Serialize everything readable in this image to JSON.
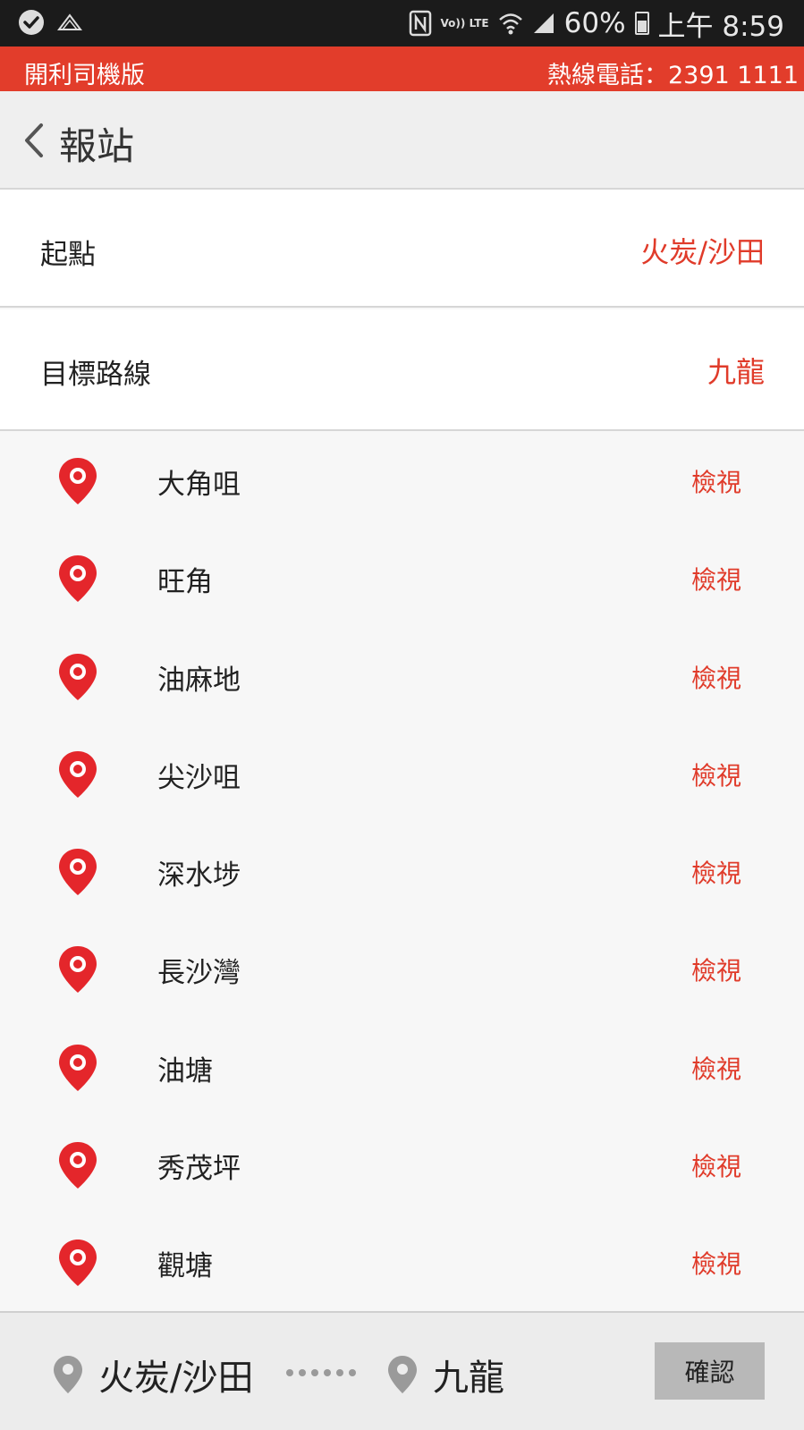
{
  "status_bar": {
    "battery": "60%",
    "time": "上午 8:59",
    "volte_label": "Vo)) LTE"
  },
  "banner": {
    "app_name": "開利司機版",
    "hotline": "熱線電話：2391 1111"
  },
  "header": {
    "title": "報站"
  },
  "origin": {
    "label": "起點",
    "value": "火炭/沙田"
  },
  "route": {
    "label": "目標路線",
    "value": "九龍"
  },
  "stations": [
    {
      "name": "大角咀",
      "action": "檢視"
    },
    {
      "name": "旺角",
      "action": "檢視"
    },
    {
      "name": "油麻地",
      "action": "檢視"
    },
    {
      "name": "尖沙咀",
      "action": "檢視"
    },
    {
      "name": "深水埗",
      "action": "檢視"
    },
    {
      "name": "長沙灣",
      "action": "檢視"
    },
    {
      "name": "油塘",
      "action": "檢視"
    },
    {
      "name": "秀茂坪",
      "action": "檢視"
    },
    {
      "name": "觀塘",
      "action": "檢視"
    }
  ],
  "bottom_bar": {
    "from": "火炭/沙田",
    "to": "九龍",
    "confirm_label": "確認"
  },
  "colors": {
    "accent": "#e23d2b",
    "accent_text": "#e03b2a",
    "status_bar_bg": "#1b1b1b"
  }
}
